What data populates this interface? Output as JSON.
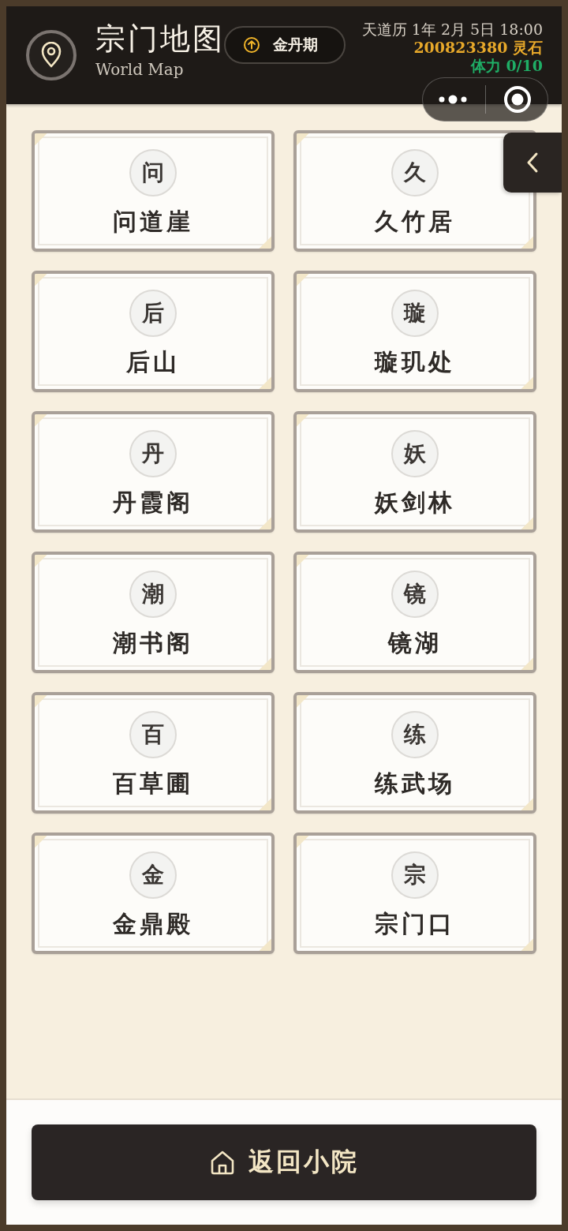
{
  "header": {
    "title": "宗门地图",
    "subtitle": "World Map",
    "realm": "金丹期",
    "date": "天道历 1年 2月 5日 18:00",
    "spirit_stones": "200823380 灵石",
    "stamina": "体力 0/10"
  },
  "locations": [
    {
      "initial": "问",
      "name": "问道崖"
    },
    {
      "initial": "久",
      "name": "久竹居"
    },
    {
      "initial": "后",
      "name": "后山"
    },
    {
      "initial": "璇",
      "name": "璇玑处"
    },
    {
      "initial": "丹",
      "name": "丹霞阁"
    },
    {
      "initial": "妖",
      "name": "妖剑林"
    },
    {
      "initial": "潮",
      "name": "潮书阁"
    },
    {
      "initial": "镜",
      "name": "镜湖"
    },
    {
      "initial": "百",
      "name": "百草圃"
    },
    {
      "initial": "练",
      "name": "练武场"
    },
    {
      "initial": "金",
      "name": "金鼎殿"
    },
    {
      "initial": "宗",
      "name": "宗门口"
    }
  ],
  "back_button": {
    "label": "返回小院"
  }
}
